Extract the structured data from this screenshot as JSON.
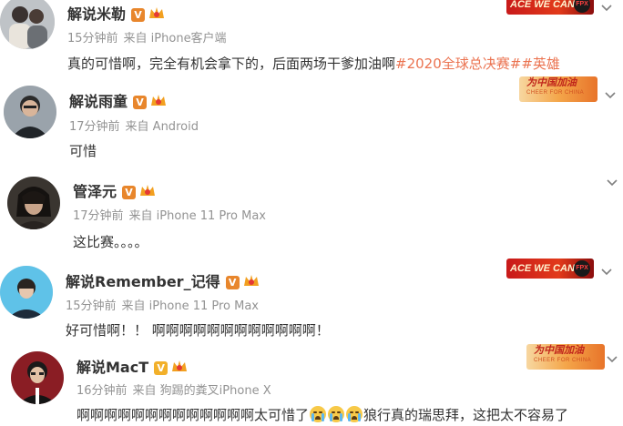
{
  "colors": {
    "username": "#333333",
    "meta": "#939393",
    "topic_link": "#eb7350",
    "verified_badge": "#e8862c"
  },
  "comments": [
    {
      "username": "解说米勒",
      "verified_badge": "V",
      "time": "15分钟前",
      "source": "来自 iPhone客户端",
      "text": "真的可惜啊，完全有机会拿下的，后面两场干爹加油啊",
      "topics": "#2020全球总决赛##英雄",
      "banner": "ACE WE CAN",
      "banner_logo": "FPX"
    },
    {
      "username": "解说雨童",
      "verified_badge": "V",
      "time": "17分钟前",
      "source": "来自 Android",
      "text": "可惜",
      "banner": "为中国加油",
      "banner_sub": "CHEER FOR CHINA"
    },
    {
      "username": "管泽元",
      "verified_badge": "V",
      "time": "17分钟前",
      "source": "来自 iPhone 11 Pro Max",
      "text": "这比赛。。。。"
    },
    {
      "username": "解说Remember_记得",
      "verified_badge": "V",
      "time": "15分钟前",
      "source": "来自 iPhone 11 Pro Max",
      "text": "好可惜啊！！ 啊啊啊啊啊啊啊啊啊啊啊啊！",
      "banner": "ACE WE CAN",
      "banner_logo": "FPX"
    },
    {
      "username": "解说MacT",
      "verified_badge": "V",
      "time": "16分钟前",
      "source": "来自 狗踢的粪叉iPhone X",
      "text_before": "啊啊啊啊啊啊啊啊啊啊啊啊啊太可惜了",
      "text_after": "狼行真的瑞思拜，这把太不容易了",
      "emoji": "crying-emoji",
      "banner": "为中国加油",
      "banner_sub": "CHEER FOR CHINA"
    }
  ]
}
